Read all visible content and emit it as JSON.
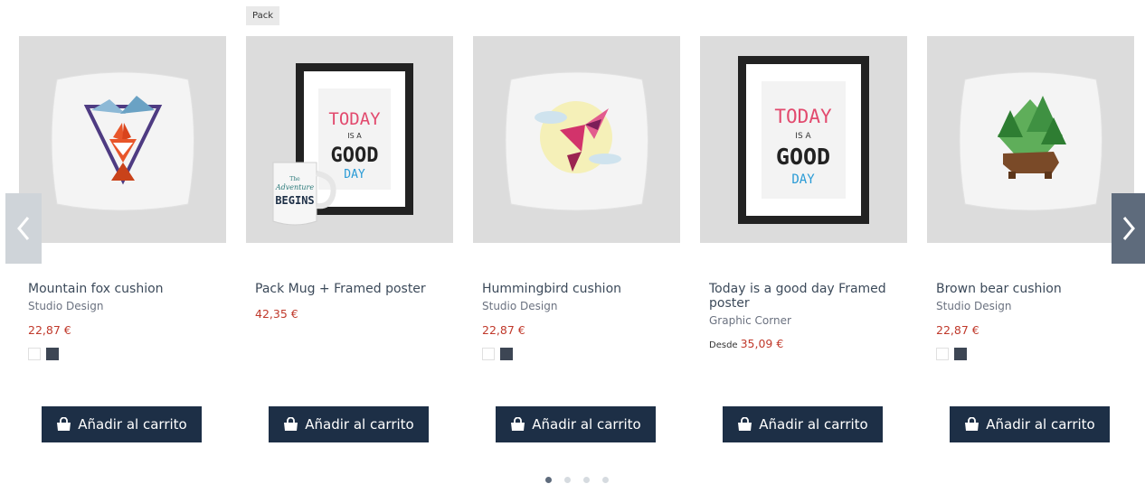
{
  "carousel": {
    "prev_icon": "chevron-left-icon",
    "next_icon": "chevron-right-icon",
    "dots_total": 4,
    "active_dot": 1
  },
  "products": [
    {
      "name": "Mountain fox cushion",
      "brand": "Studio Design",
      "price": "22,87 €",
      "colors": [
        "#ffffff",
        "#3d4654"
      ],
      "button_label": "Añadir al carrito",
      "image": "fox-cushion"
    },
    {
      "badge": "Pack",
      "name": "Pack Mug + Framed poster",
      "price": "42,35 €",
      "button_label": "Añadir al carrito",
      "image": "mug-and-poster"
    },
    {
      "name": "Hummingbird cushion",
      "brand": "Studio Design",
      "price": "22,87 €",
      "colors": [
        "#ffffff",
        "#3d4654"
      ],
      "button_label": "Añadir al carrito",
      "image": "hummingbird-cushion"
    },
    {
      "name": "Today is a good day Framed poster",
      "brand": "Graphic Corner",
      "price_prefix": "Desde",
      "price": "35,09 €",
      "button_label": "Añadir al carrito",
      "image": "framed-poster"
    },
    {
      "name": "Brown bear cushion",
      "brand": "Studio Design",
      "price": "22,87 €",
      "colors": [
        "#ffffff",
        "#3d4654"
      ],
      "button_label": "Añadir al carrito",
      "image": "bear-cushion"
    }
  ],
  "artwork_text": {
    "poster_line1": "TODAY",
    "poster_line2": "IS A",
    "poster_line3": "GOOD",
    "poster_line4": "DAY",
    "mug_line1": "The",
    "mug_line2": "Adventure",
    "mug_line3": "BEGINS"
  },
  "colors": {
    "accent": "#1d2f46",
    "price": "#c0392b",
    "image_bg": "#dcdcdc"
  }
}
